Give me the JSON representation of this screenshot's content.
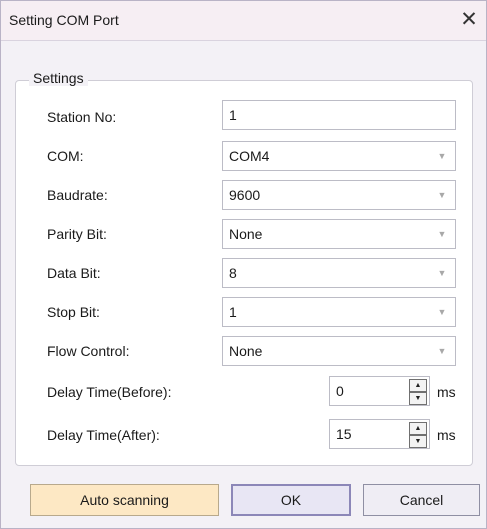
{
  "window": {
    "title": "Setting COM Port",
    "close_glyph": "✕"
  },
  "settings": {
    "group_label": "Settings",
    "station_no": {
      "label": "Station No:",
      "value": "1"
    },
    "com": {
      "label": "COM:",
      "value": "COM4"
    },
    "baudrate": {
      "label": "Baudrate:",
      "value": "9600"
    },
    "parity_bit": {
      "label": "Parity Bit:",
      "value": "None"
    },
    "data_bit": {
      "label": "Data Bit:",
      "value": "8"
    },
    "stop_bit": {
      "label": "Stop Bit:",
      "value": "1"
    },
    "flow_control": {
      "label": "Flow Control:",
      "value": "None"
    },
    "delay_before": {
      "label": "Delay Time(Before):",
      "value": "0",
      "unit": "ms"
    },
    "delay_after": {
      "label": "Delay Time(After):",
      "value": "15",
      "unit": "ms"
    }
  },
  "buttons": {
    "auto_scanning": "Auto scanning",
    "ok": "OK",
    "cancel": "Cancel"
  },
  "icons": {
    "combo_arrow": "▼",
    "spin_up": "▲",
    "spin_down": "▼"
  }
}
